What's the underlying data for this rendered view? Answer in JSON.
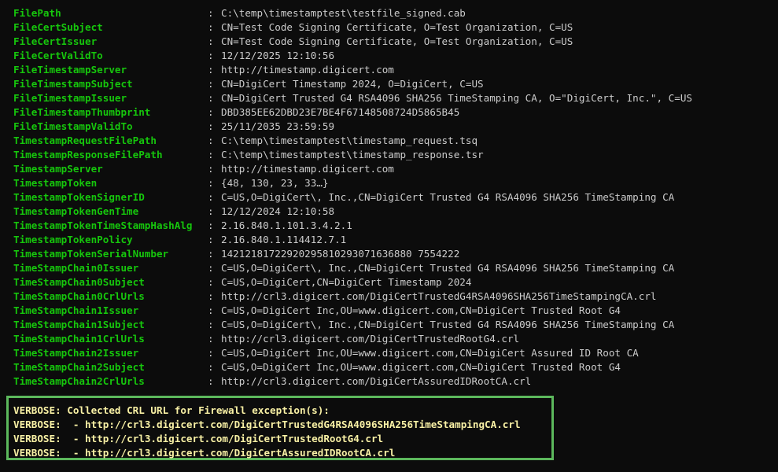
{
  "properties": [
    {
      "name": "FilePath",
      "value": "C:\\temp\\timestamptest\\testfile_signed.cab"
    },
    {
      "name": "FileCertSubject",
      "value": "CN=Test Code Signing Certificate, O=Test Organization, C=US"
    },
    {
      "name": "FileCertIssuer",
      "value": "CN=Test Code Signing Certificate, O=Test Organization, C=US"
    },
    {
      "name": "FileCertValidTo",
      "value": "12/12/2025 12:10:56"
    },
    {
      "name": "FileTimestampServer",
      "value": "http://timestamp.digicert.com"
    },
    {
      "name": "FileTimestampSubject",
      "value": "CN=DigiCert Timestamp 2024, O=DigiCert, C=US"
    },
    {
      "name": "FileTimestampIssuer",
      "value": "CN=DigiCert Trusted G4 RSA4096 SHA256 TimeStamping CA, O=\"DigiCert, Inc.\", C=US"
    },
    {
      "name": "FileTimestampThumbprint",
      "value": "DBD385EE62DBD23E7BE4F67148508724D5865B45"
    },
    {
      "name": "FileTimestampValidTo",
      "value": "25/11/2035 23:59:59"
    },
    {
      "name": "TimestampRequestFilePath",
      "value": "C:\\temp\\timestamptest\\timestamp_request.tsq"
    },
    {
      "name": "TimestampResponseFilePath",
      "value": "C:\\temp\\timestamptest\\timestamp_response.tsr"
    },
    {
      "name": "TimestampServer",
      "value": "http://timestamp.digicert.com"
    },
    {
      "name": "TimestampToken",
      "value": "{48, 130, 23, 33…}"
    },
    {
      "name": "TimestampTokenSignerID",
      "value": "C=US,O=DigiCert\\, Inc.,CN=DigiCert Trusted G4 RSA4096 SHA256 TimeStamping CA"
    },
    {
      "name": "TimestampTokenGenTime",
      "value": "12/12/2024 12:10:58"
    },
    {
      "name": "TimestampTokenTimeStampHashAlg",
      "value": "2.16.840.1.101.3.4.2.1"
    },
    {
      "name": "TimestampTokenPolicy",
      "value": "2.16.840.1.114412.7.1"
    },
    {
      "name": "TimestampTokenSerialNumber",
      "value": "14212181722920295810293071636880 7554222"
    },
    {
      "name": "TimeStampChain0Issuer",
      "value": "C=US,O=DigiCert\\, Inc.,CN=DigiCert Trusted G4 RSA4096 SHA256 TimeStamping CA"
    },
    {
      "name": "TimeStampChain0Subject",
      "value": "C=US,O=DigiCert,CN=DigiCert Timestamp 2024"
    },
    {
      "name": "TimeStampChain0CrlUrls",
      "value": "http://crl3.digicert.com/DigiCertTrustedG4RSA4096SHA256TimeStampingCA.crl"
    },
    {
      "name": "TimeStampChain1Issuer",
      "value": "C=US,O=DigiCert Inc,OU=www.digicert.com,CN=DigiCert Trusted Root G4"
    },
    {
      "name": "TimeStampChain1Subject",
      "value": "C=US,O=DigiCert\\, Inc.,CN=DigiCert Trusted G4 RSA4096 SHA256 TimeStamping CA"
    },
    {
      "name": "TimeStampChain1CrlUrls",
      "value": "http://crl3.digicert.com/DigiCertTrustedRootG4.crl"
    },
    {
      "name": "TimeStampChain2Issuer",
      "value": "C=US,O=DigiCert Inc,OU=www.digicert.com,CN=DigiCert Assured ID Root CA"
    },
    {
      "name": "TimeStampChain2Subject",
      "value": "C=US,O=DigiCert Inc,OU=www.digicert.com,CN=DigiCert Trusted Root G4"
    },
    {
      "name": "TimeStampChain2CrlUrls",
      "value": "http://crl3.digicert.com/DigiCertAssuredIDRootCA.crl"
    }
  ],
  "separator": ":",
  "verbose": {
    "prefix": "VERBOSE:",
    "header": "Collected CRL URL for Firewall exception(s):",
    "dash": "-",
    "urls": [
      "http://crl3.digicert.com/DigiCertTrustedG4RSA4096SHA256TimeStampingCA.crl",
      "http://crl3.digicert.com/DigiCertTrustedRootG4.crl",
      "http://crl3.digicert.com/DigiCertAssuredIDRootCA.crl"
    ]
  },
  "colors": {
    "background": "#0c0c0c",
    "property_name": "#16c60c",
    "value_text": "#cccccc",
    "verbose_text": "#f9f1a5",
    "highlight_border": "#5cb85c"
  }
}
